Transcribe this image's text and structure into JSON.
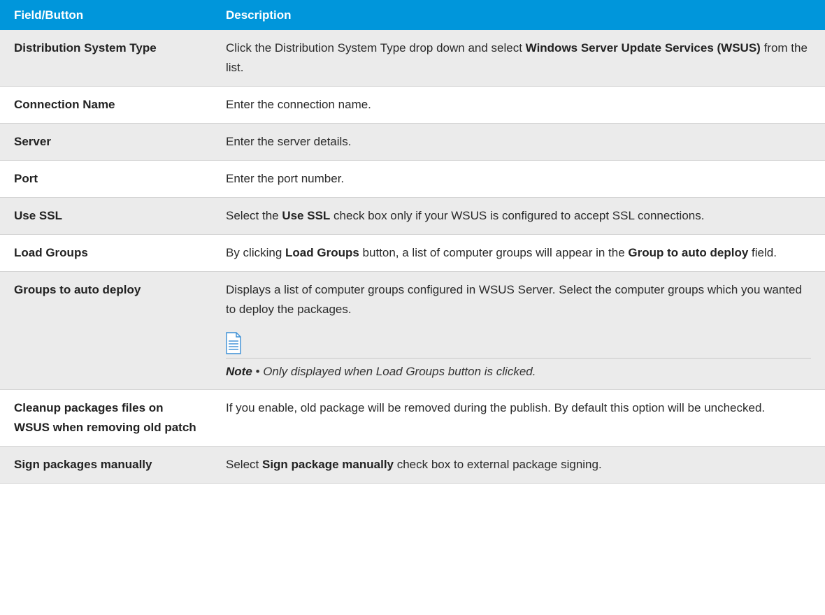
{
  "table": {
    "headers": {
      "field": "Field/Button",
      "description": "Description"
    },
    "rows": [
      {
        "field": "Distribution System Type",
        "desc": [
          {
            "t": "Click the Distribution System Type drop down and select "
          },
          {
            "t": "Windows Server Update Services (WSUS)",
            "b": true
          },
          {
            "t": " from the list."
          }
        ]
      },
      {
        "field": "Connection Name",
        "desc": [
          {
            "t": "Enter the connection name."
          }
        ]
      },
      {
        "field": "Server",
        "desc": [
          {
            "t": "Enter the server details."
          }
        ]
      },
      {
        "field": "Port",
        "desc": [
          {
            "t": "Enter the port number."
          }
        ]
      },
      {
        "field": "Use SSL",
        "desc": [
          {
            "t": "Select the "
          },
          {
            "t": "Use SSL",
            "b": true
          },
          {
            "t": " check box only if your WSUS is configured to accept SSL connections."
          }
        ]
      },
      {
        "field": "Load Groups",
        "desc": [
          {
            "t": "By clicking "
          },
          {
            "t": "Load Groups",
            "b": true
          },
          {
            "t": " button, a list of computer groups will appear in the "
          },
          {
            "t": "Group to auto deploy",
            "b": true
          },
          {
            "t": " field."
          }
        ]
      },
      {
        "field": "Groups to auto deploy",
        "desc": [
          {
            "t": "Displays a list of computer groups configured in WSUS Server. Select the computer groups which you wanted to deploy the packages."
          }
        ],
        "note": {
          "icon": "note-document-icon",
          "label": "Note",
          "separator": " • ",
          "text": "Only displayed when Load Groups button is clicked."
        }
      },
      {
        "field": "Cleanup packages files on WSUS when removing old patch",
        "desc": [
          {
            "t": "If you enable, old package will be removed during the publish. By default this option will be unchecked."
          }
        ]
      },
      {
        "field": "Sign packages manually",
        "desc": [
          {
            "t": "Select "
          },
          {
            "t": "Sign package manually",
            "b": true
          },
          {
            "t": " check box to external package signing."
          }
        ]
      }
    ]
  },
  "colors": {
    "header_bg": "#0096db",
    "alt_row_bg": "#ebebeb",
    "icon_blue": "#3a8fd6"
  }
}
